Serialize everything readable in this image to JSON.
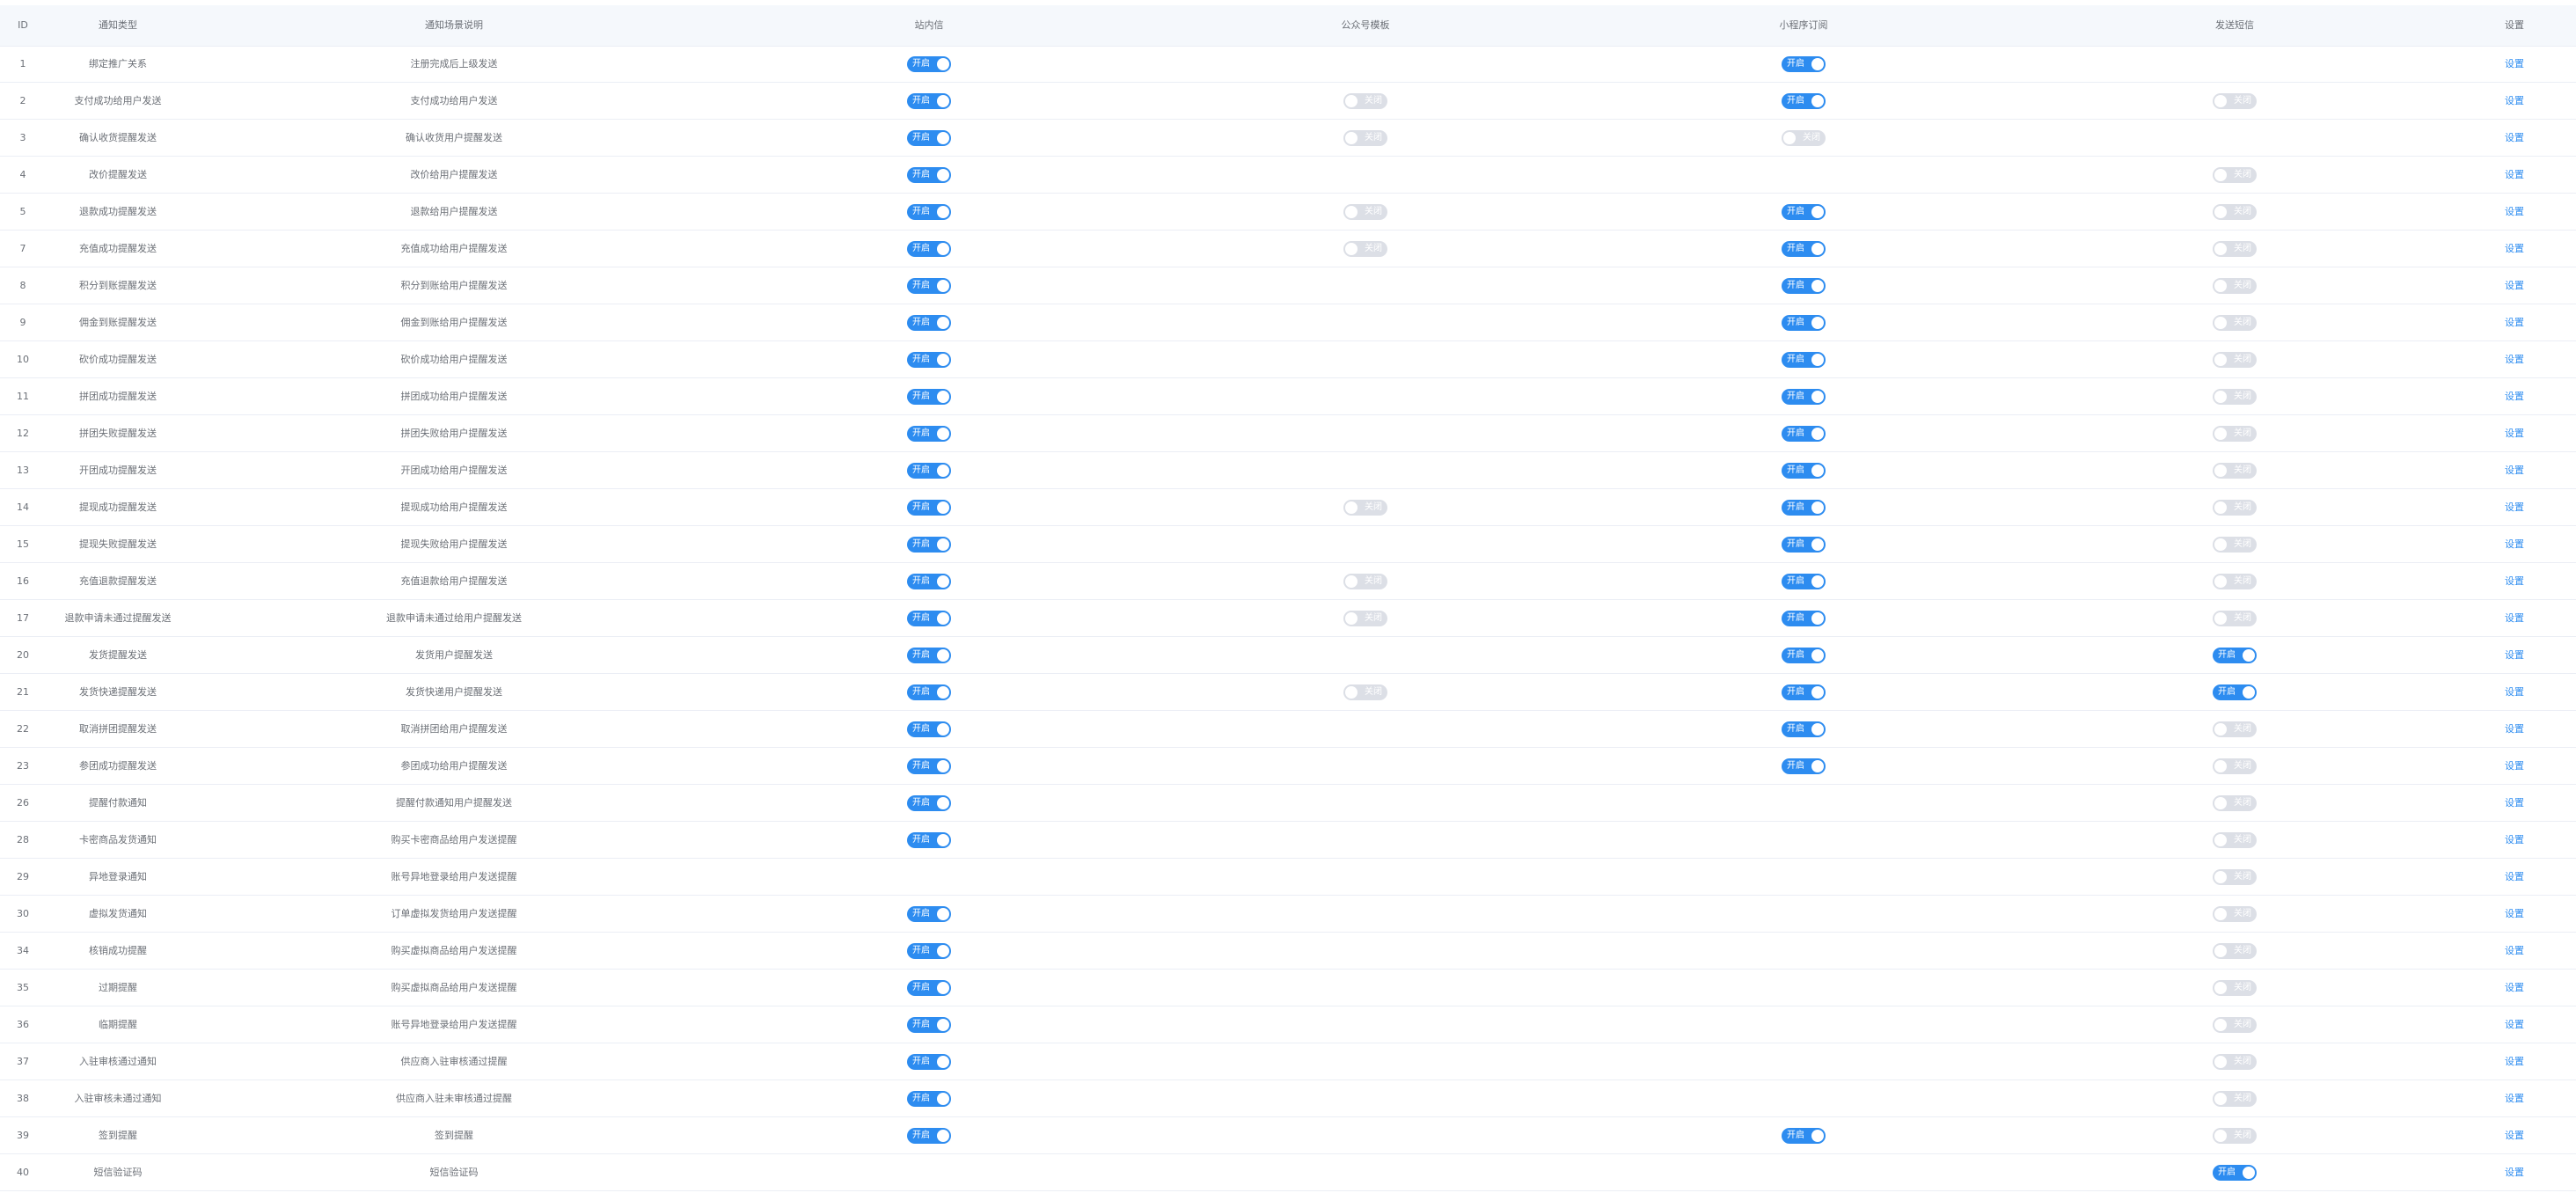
{
  "headers": {
    "id": "ID",
    "type": "通知类型",
    "scene": "通知场景说明",
    "site": "站内信",
    "wechat": "公众号模板",
    "mini": "小程序订阅",
    "sms": "发送短信",
    "setting": "设置"
  },
  "switch_labels": {
    "on": "开启",
    "off": "关闭"
  },
  "setting_label": "设置",
  "colors": {
    "switch_on": "#2d8cf0",
    "switch_off": "#dcdfe6",
    "link": "#2d8cf0",
    "header_bg": "#f5f8fc"
  },
  "rows": [
    {
      "id": "1",
      "type": "绑定推广关系",
      "scene": "注册完成后上级发送",
      "site": "on",
      "wechat": null,
      "mini": "on",
      "sms": null
    },
    {
      "id": "2",
      "type": "支付成功给用户发送",
      "scene": "支付成功给用户发送",
      "site": "on",
      "wechat": "off",
      "mini": "on",
      "sms": "off"
    },
    {
      "id": "3",
      "type": "确认收货提醒发送",
      "scene": "确认收货用户提醒发送",
      "site": "on",
      "wechat": "off",
      "mini": "off",
      "sms": null
    },
    {
      "id": "4",
      "type": "改价提醒发送",
      "scene": "改价给用户提醒发送",
      "site": "on",
      "wechat": null,
      "mini": null,
      "sms": "off"
    },
    {
      "id": "5",
      "type": "退款成功提醒发送",
      "scene": "退款给用户提醒发送",
      "site": "on",
      "wechat": "off",
      "mini": "on",
      "sms": "off"
    },
    {
      "id": "7",
      "type": "充值成功提醒发送",
      "scene": "充值成功给用户提醒发送",
      "site": "on",
      "wechat": "off",
      "mini": "on",
      "sms": "off"
    },
    {
      "id": "8",
      "type": "积分到账提醒发送",
      "scene": "积分到账给用户提醒发送",
      "site": "on",
      "wechat": null,
      "mini": "on",
      "sms": "off"
    },
    {
      "id": "9",
      "type": "佣金到账提醒发送",
      "scene": "佣金到账给用户提醒发送",
      "site": "on",
      "wechat": null,
      "mini": "on",
      "sms": "off"
    },
    {
      "id": "10",
      "type": "砍价成功提醒发送",
      "scene": "砍价成功给用户提醒发送",
      "site": "on",
      "wechat": null,
      "mini": "on",
      "sms": "off"
    },
    {
      "id": "11",
      "type": "拼团成功提醒发送",
      "scene": "拼团成功给用户提醒发送",
      "site": "on",
      "wechat": null,
      "mini": "on",
      "sms": "off"
    },
    {
      "id": "12",
      "type": "拼团失败提醒发送",
      "scene": "拼团失败给用户提醒发送",
      "site": "on",
      "wechat": null,
      "mini": "on",
      "sms": "off"
    },
    {
      "id": "13",
      "type": "开团成功提醒发送",
      "scene": "开团成功给用户提醒发送",
      "site": "on",
      "wechat": null,
      "mini": "on",
      "sms": "off"
    },
    {
      "id": "14",
      "type": "提现成功提醒发送",
      "scene": "提现成功给用户提醒发送",
      "site": "on",
      "wechat": "off",
      "mini": "on",
      "sms": "off"
    },
    {
      "id": "15",
      "type": "提现失败提醒发送",
      "scene": "提现失败给用户提醒发送",
      "site": "on",
      "wechat": null,
      "mini": "on",
      "sms": "off"
    },
    {
      "id": "16",
      "type": "充值退款提醒发送",
      "scene": "充值退款给用户提醒发送",
      "site": "on",
      "wechat": "off",
      "mini": "on",
      "sms": "off"
    },
    {
      "id": "17",
      "type": "退款申请未通过提醒发送",
      "scene": "退款申请未通过给用户提醒发送",
      "site": "on",
      "wechat": "off",
      "mini": "on",
      "sms": "off"
    },
    {
      "id": "20",
      "type": "发货提醒发送",
      "scene": "发货用户提醒发送",
      "site": "on",
      "wechat": null,
      "mini": "on",
      "sms": "on"
    },
    {
      "id": "21",
      "type": "发货快递提醒发送",
      "scene": "发货快递用户提醒发送",
      "site": "on",
      "wechat": "off",
      "mini": "on",
      "sms": "on"
    },
    {
      "id": "22",
      "type": "取消拼团提醒发送",
      "scene": "取消拼团给用户提醒发送",
      "site": "on",
      "wechat": null,
      "mini": "on",
      "sms": "off"
    },
    {
      "id": "23",
      "type": "参团成功提醒发送",
      "scene": "参团成功给用户提醒发送",
      "site": "on",
      "wechat": null,
      "mini": "on",
      "sms": "off"
    },
    {
      "id": "26",
      "type": "提醒付款通知",
      "scene": "提醒付款通知用户提醒发送",
      "site": "on",
      "wechat": null,
      "mini": null,
      "sms": "off"
    },
    {
      "id": "28",
      "type": "卡密商品发货通知",
      "scene": "购买卡密商品给用户发送提醒",
      "site": "on",
      "wechat": null,
      "mini": null,
      "sms": "off"
    },
    {
      "id": "29",
      "type": "异地登录通知",
      "scene": "账号异地登录给用户发送提醒",
      "site": null,
      "wechat": null,
      "mini": null,
      "sms": "off"
    },
    {
      "id": "30",
      "type": "虚拟发货通知",
      "scene": "订单虚拟发货给用户发送提醒",
      "site": "on",
      "wechat": null,
      "mini": null,
      "sms": "off"
    },
    {
      "id": "34",
      "type": "核销成功提醒",
      "scene": "购买虚拟商品给用户发送提醒",
      "site": "on",
      "wechat": null,
      "mini": null,
      "sms": "off"
    },
    {
      "id": "35",
      "type": "过期提醒",
      "scene": "购买虚拟商品给用户发送提醒",
      "site": "on",
      "wechat": null,
      "mini": null,
      "sms": "off"
    },
    {
      "id": "36",
      "type": "临期提醒",
      "scene": "账号异地登录给用户发送提醒",
      "site": "on",
      "wechat": null,
      "mini": null,
      "sms": "off"
    },
    {
      "id": "37",
      "type": "入驻审核通过通知",
      "scene": "供应商入驻审核通过提醒",
      "site": "on",
      "wechat": null,
      "mini": null,
      "sms": "off"
    },
    {
      "id": "38",
      "type": "入驻审核未通过通知",
      "scene": "供应商入驻未审核通过提醒",
      "site": "on",
      "wechat": null,
      "mini": null,
      "sms": "off"
    },
    {
      "id": "39",
      "type": "签到提醒",
      "scene": "签到提醒",
      "site": "on",
      "wechat": null,
      "mini": "on",
      "sms": "off"
    },
    {
      "id": "40",
      "type": "短信验证码",
      "scene": "短信验证码",
      "site": null,
      "wechat": null,
      "mini": null,
      "sms": "on"
    }
  ]
}
